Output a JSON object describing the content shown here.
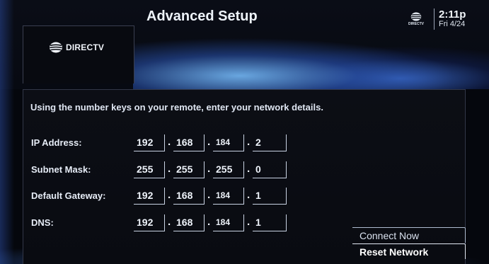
{
  "header": {
    "title": "Advanced Setup",
    "brand": "DIRECTV",
    "status_brand": "DIRECTV",
    "time": "2:11p",
    "date": "Fri 4/24"
  },
  "instructions": "Using the number keys on your remote, enter your network details.",
  "fields": [
    {
      "label": "IP Address:",
      "octets": [
        "192",
        "168",
        "184",
        "2"
      ]
    },
    {
      "label": "Subnet Mask:",
      "octets": [
        "255",
        "255",
        "255",
        "0"
      ]
    },
    {
      "label": "Default Gateway:",
      "octets": [
        "192",
        "168",
        "184",
        "1"
      ]
    },
    {
      "label": "DNS:",
      "octets": [
        "192",
        "168",
        "184",
        "1"
      ]
    }
  ],
  "separator": ".",
  "buttons": {
    "connect_now": "Connect Now",
    "reset_network": "Reset Network"
  },
  "colors": {
    "background": "#05070d",
    "panel": "#0c0e15",
    "text": "#e8eef8",
    "accent_blue": "#3a78d0"
  }
}
